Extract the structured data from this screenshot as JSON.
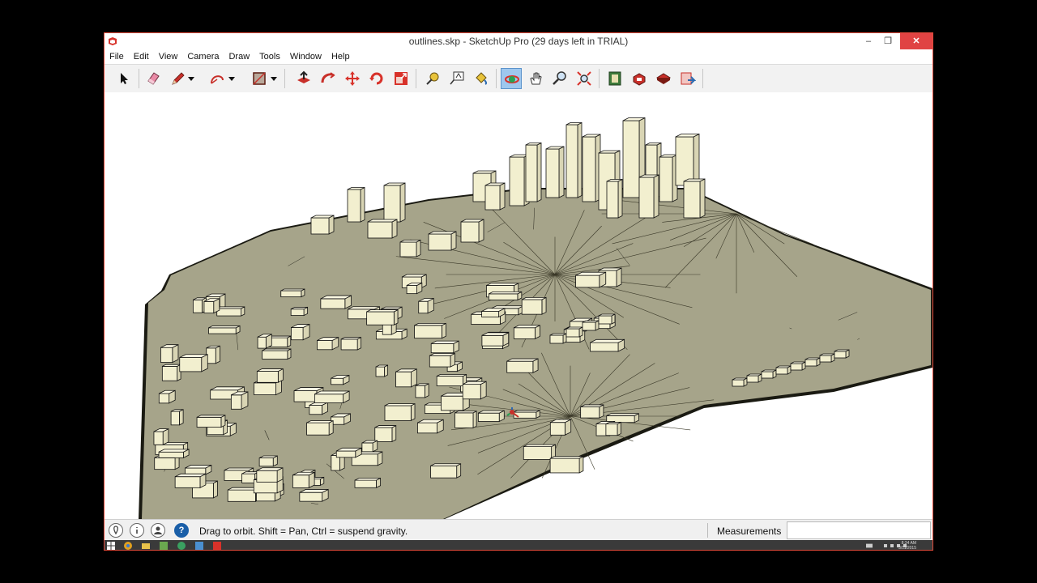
{
  "window": {
    "title": "outlines.skp - SketchUp Pro (29 days left in TRIAL)"
  },
  "menu": [
    "File",
    "Edit",
    "View",
    "Camera",
    "Draw",
    "Tools",
    "Window",
    "Help"
  ],
  "toolbar": {
    "tools": [
      {
        "name": "select-icon"
      },
      {
        "name": "eraser-icon"
      },
      {
        "name": "pencil-icon"
      },
      {
        "name": "arc-icon"
      },
      {
        "name": "rectangle-icon"
      },
      {
        "name": "push-pull-icon"
      },
      {
        "name": "follow-me-icon"
      },
      {
        "name": "move-icon"
      },
      {
        "name": "rotate-icon"
      },
      {
        "name": "scale-icon"
      },
      {
        "name": "tape-measure-icon"
      },
      {
        "name": "text-icon"
      },
      {
        "name": "paint-bucket-icon"
      },
      {
        "name": "orbit-icon",
        "active": true
      },
      {
        "name": "pan-icon"
      },
      {
        "name": "zoom-icon"
      },
      {
        "name": "zoom-extents-icon"
      },
      {
        "name": "warehouse-icon"
      },
      {
        "name": "extensions-icon"
      },
      {
        "name": "extension-warehouse-icon"
      },
      {
        "name": "layout-icon"
      }
    ]
  },
  "status": {
    "hint": "Drag to orbit. Shift = Pan, Ctrl = suspend gravity.",
    "measurements_label": "Measurements",
    "measurements_value": ""
  },
  "taskbar": {
    "clock_time": "8:34 AM",
    "clock_date": "3/11/2015"
  },
  "colors": {
    "terrain": "#a6a48a",
    "building": "#f2efcf",
    "close_button": "#e04343",
    "active_tool": "#9ec7ee"
  }
}
